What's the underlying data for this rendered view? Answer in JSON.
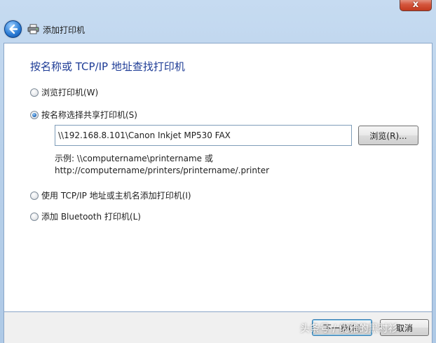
{
  "window": {
    "title": "添加打印机",
    "close_label": "x"
  },
  "main": {
    "heading": "按名称或 TCP/IP 地址查找打印机",
    "options": [
      {
        "label": "浏览打印机(W)",
        "checked": false
      },
      {
        "label": "按名称选择共享打印机(S)",
        "checked": true
      },
      {
        "label": "使用 TCP/IP 地址或主机名添加打印机(I)",
        "checked": false
      },
      {
        "label": "添加 Bluetooth 打印机(L)",
        "checked": false
      }
    ],
    "printer_path": "\\\\192.168.8.101\\Canon Inkjet MP530 FAX",
    "browse_label": "浏览(R)...",
    "example_line1": "示例: \\\\computername\\printername 或",
    "example_line2": "http://computername/printers/printername/.printer"
  },
  "footer": {
    "next_label": "下一步(N)",
    "cancel_label": "取消"
  },
  "watermark": "头条号 / 优雅的黑衬衫"
}
